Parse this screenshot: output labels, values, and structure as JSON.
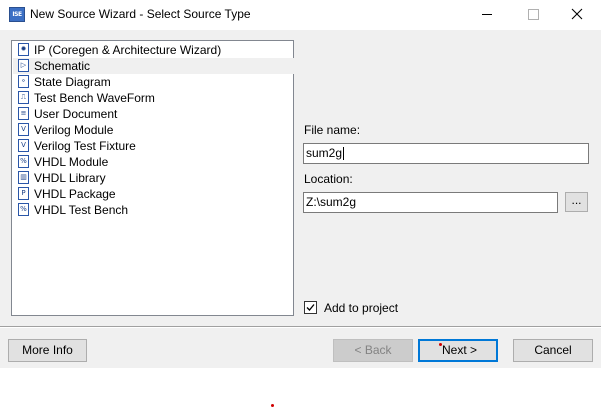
{
  "window": {
    "title": "New Source Wizard - Select Source Type",
    "app_icon_text": "ISE"
  },
  "source_types": [
    {
      "label": "IP (Coregen & Architecture Wizard)",
      "icon": "ip-wizard-icon",
      "icon_glyph": "✹",
      "selected": false
    },
    {
      "label": "Schematic",
      "icon": "schematic-icon",
      "icon_glyph": "▷",
      "selected": true
    },
    {
      "label": "State Diagram",
      "icon": "state-diagram-icon",
      "icon_glyph": "⚬",
      "selected": false
    },
    {
      "label": "Test Bench WaveForm",
      "icon": "waveform-icon",
      "icon_glyph": "⎍",
      "selected": false
    },
    {
      "label": "User Document",
      "icon": "document-icon",
      "icon_glyph": "≡",
      "selected": false
    },
    {
      "label": "Verilog Module",
      "icon": "verilog-module-icon",
      "icon_glyph": "V",
      "selected": false
    },
    {
      "label": "Verilog Test Fixture",
      "icon": "verilog-test-fixture-icon",
      "icon_glyph": "V",
      "selected": false
    },
    {
      "label": "VHDL Module",
      "icon": "vhdl-module-icon",
      "icon_glyph": "%",
      "selected": false
    },
    {
      "label": "VHDL Library",
      "icon": "vhdl-library-icon",
      "icon_glyph": "▥",
      "selected": false
    },
    {
      "label": "VHDL Package",
      "icon": "vhdl-package-icon",
      "icon_glyph": "P",
      "selected": false
    },
    {
      "label": "VHDL Test Bench",
      "icon": "vhdl-test-bench-icon",
      "icon_glyph": "%",
      "selected": false
    }
  ],
  "file_name": {
    "label": "File name:",
    "value": "sum2g"
  },
  "location": {
    "label": "Location:",
    "value": "Z:\\sum2g",
    "browse_label": "..."
  },
  "add_to_project": {
    "label": "Add to project",
    "checked": true
  },
  "buttons": {
    "more_info": "More Info",
    "back": "< Back",
    "next": "Next >",
    "cancel": "Cancel"
  },
  "colors": {
    "accent": "#0078d7",
    "list_selection": "#f0f0f0",
    "dialog_background": "#f0f0f0"
  }
}
